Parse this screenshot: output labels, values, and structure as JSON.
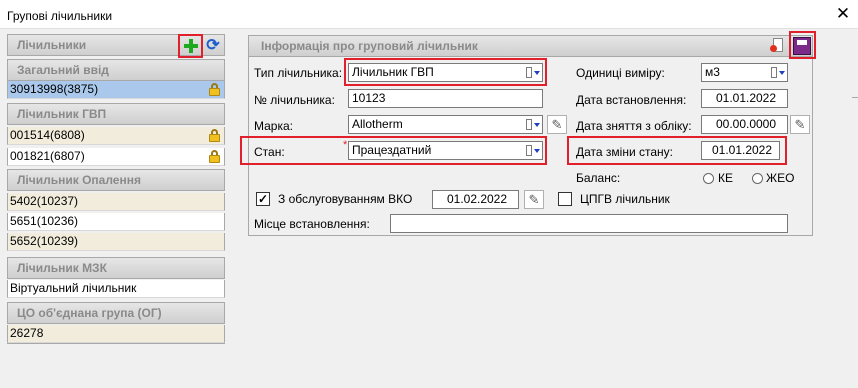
{
  "window": {
    "title": "Групові лічильники",
    "close_glyph": "✕"
  },
  "left": {
    "header": "Лічильники",
    "groups": [
      {
        "title": "Загальний ввід",
        "items": [
          {
            "label": "30913998(3875)",
            "locked": true,
            "selected": true
          }
        ]
      },
      {
        "title": "Лічильник ГВП",
        "items": [
          {
            "label": "001514(6808)",
            "locked": true
          },
          {
            "label": "001821(6807)",
            "locked": true
          }
        ]
      },
      {
        "title": "Лічильник Опалення",
        "items": [
          {
            "label": "5402(10237)"
          },
          {
            "label": "5651(10236)"
          },
          {
            "label": "5652(10239)"
          }
        ]
      },
      {
        "title": "Лічильник МЗК",
        "items": [
          {
            "label": "Віртуальний лічильник"
          }
        ]
      },
      {
        "title": "ЦО об'єднана група (ОГ)",
        "items": [
          {
            "label": "26278"
          }
        ]
      }
    ]
  },
  "info": {
    "header": "Інформація про груповий лічильник",
    "type_label": "Тип лічильника:",
    "type_value": "Лічильник ГВП",
    "number_label": "№ лічильника:",
    "number_value": "10123",
    "brand_label": "Марка:",
    "brand_value": "Allotherm",
    "state_label": "Стан:",
    "state_required": "*",
    "state_value": "Працездатний",
    "unit_label": "Одиниці виміру:",
    "unit_value": "м3",
    "install_date_label": "Дата встановлення:",
    "install_date_value": "01.01.2022",
    "remove_date_label": "Дата зняття з обліку:",
    "remove_date_value": "00.00.0000",
    "state_change_label": "Дата зміни стану:",
    "state_change_value": "01.01.2022",
    "balance_label": "Баланс:",
    "balance_ke": "КЕ",
    "balance_zheo": "ЖЕО",
    "vko_label": "З обслуговуванням ВКО",
    "vko_checked": true,
    "vko_date": "01.02.2022",
    "cpgv_label": "ЦПГВ лічильник",
    "cpgv_checked": false,
    "location_label": "Місце встановлення:",
    "location_value": ""
  },
  "colors": {
    "highlight": "#e0202a",
    "selected_row": "#a9c8ec",
    "row_bg": "#f2ecdc",
    "add_green": "#1fa91f"
  }
}
